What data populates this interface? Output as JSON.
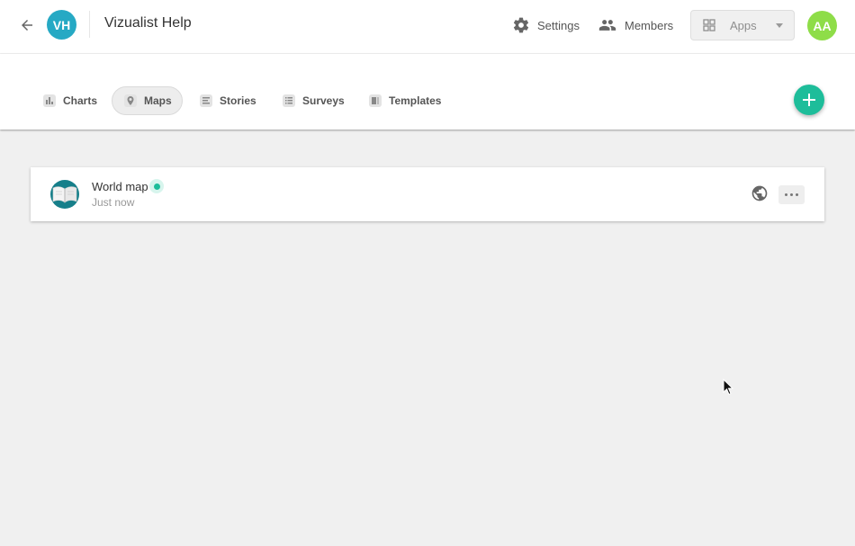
{
  "header": {
    "workspace_initials": "VH",
    "workspace_name": "Vizualist Help",
    "settings_label": "Settings",
    "members_label": "Members",
    "apps_label": "Apps",
    "user_initials": "AA"
  },
  "tabs": [
    {
      "label": "Charts",
      "icon": "bar-chart-icon",
      "active": false
    },
    {
      "label": "Maps",
      "icon": "map-pin-icon",
      "active": true
    },
    {
      "label": "Stories",
      "icon": "document-icon",
      "active": false
    },
    {
      "label": "Surveys",
      "icon": "list-icon",
      "active": false
    },
    {
      "label": "Templates",
      "icon": "template-icon",
      "active": false
    }
  ],
  "items": [
    {
      "title": "World map",
      "subtitle": "Just now",
      "status": "published",
      "thumb_icon": "open-book-icon"
    }
  ],
  "colors": {
    "accent": "#1ebd9a",
    "workspace_avatar": "#26a9c4",
    "user_avatar": "#8edd48",
    "background": "#f0f0f0"
  }
}
